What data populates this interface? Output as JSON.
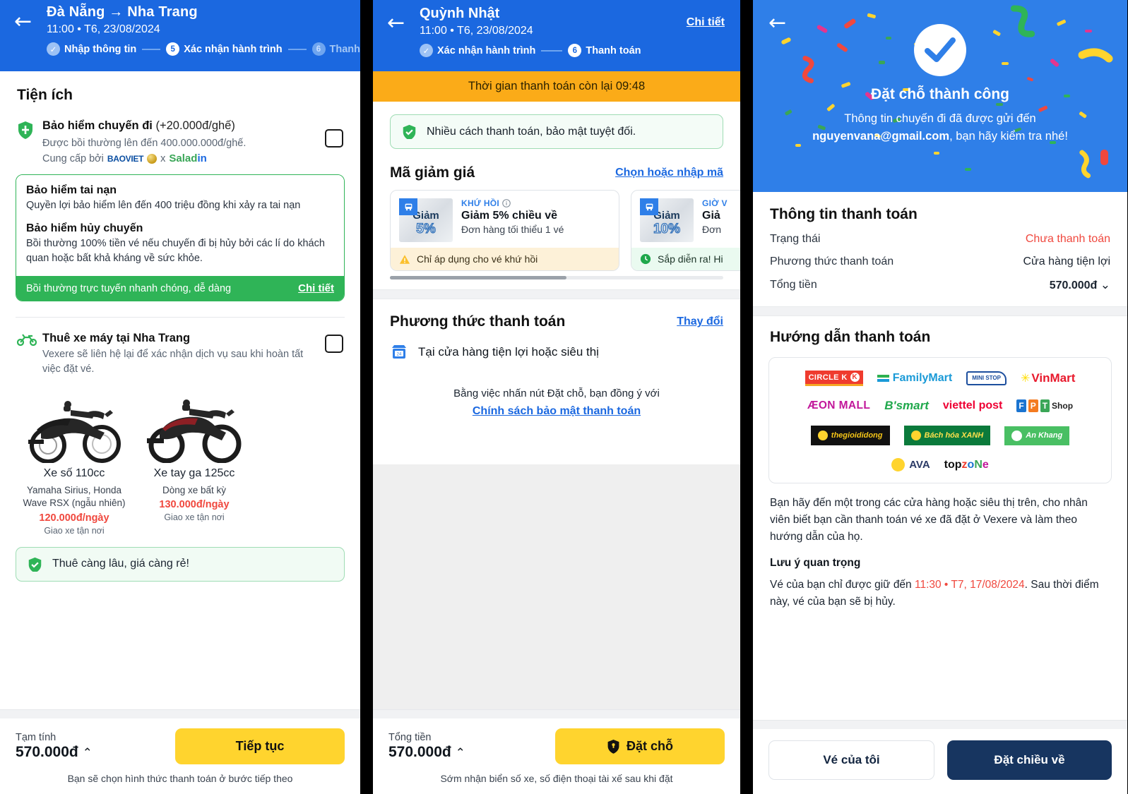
{
  "panel1": {
    "header": {
      "back_icon": "back-arrow-icon",
      "route": "Đà Nẵng → Nha Trang",
      "datetime": "11:00 • T6, 23/08/2024",
      "steps": [
        {
          "num": "✓",
          "label": "Nhập thông tin",
          "state": "done"
        },
        {
          "num": "5",
          "label": "Xác nhận hành trình",
          "state": "current"
        },
        {
          "num": "6",
          "label": "Thanh",
          "state": "next"
        }
      ]
    },
    "section_title": "Tiện ích",
    "insurance": {
      "icon": "shield-icon",
      "title": "Bảo hiểm chuyến đi",
      "price_suffix": "(+20.000đ/ghế)",
      "desc": "Được bồi thường lên đến 400.000.000đ/ghế.",
      "provided_by_label": "Cung cấp bởi",
      "brand1": "BAOVIET",
      "brand_sep": "x",
      "brand2": "Saladin",
      "checkbox": "insurance-checkbox"
    },
    "insurance_card": {
      "item1_title": "Bảo hiểm tai nạn",
      "item1_desc": "Quyền lợi bảo hiểm lên đến 400 triệu đồng khi xảy ra tai nạn",
      "item2_title": "Bảo hiểm hủy chuyến",
      "item2_desc": "Bồi thường 100% tiền vé nếu chuyến đi bị hủy bởi các lí do khách quan hoặc bất khả kháng về sức khỏe.",
      "foot_text": "Bồi thường trực tuyến nhanh chóng, dễ dàng",
      "foot_link": "Chi tiết"
    },
    "bike": {
      "icon": "motorbike-icon",
      "title": "Thuê xe máy tại Nha Trang",
      "desc": "Vexere sẽ liên hệ lại để xác nhận dịch vụ sau khi hoàn tất việc đặt vé.",
      "checkbox": "motorbike-checkbox",
      "options": [
        {
          "name": "Xe số 110cc",
          "desc": "Yamaha Sirius, Honda Wave RSX (ngẫu nhiên)",
          "price": "120.000đ/ngày",
          "note": "Giao xe tận nơi"
        },
        {
          "name": "Xe tay ga 125cc",
          "desc": "Dòng xe bất kỳ",
          "price": "130.000đ/ngày",
          "note": "Giao xe tận nơi"
        }
      ],
      "promo_note": "Thuê càng lâu, giá càng rẻ!"
    },
    "bottom": {
      "label": "Tạm tính",
      "amount": "570.000đ",
      "caret": "⌃",
      "button": "Tiếp tục",
      "foot": "Bạn sẽ chọn hình thức thanh toán ở bước tiếp theo"
    }
  },
  "panel2": {
    "header": {
      "back_icon": "back-arrow-icon",
      "title": "Quỳnh Nhật",
      "datetime": "11:00 • T6, 23/08/2024",
      "detail_link": "Chi tiết",
      "steps": [
        {
          "num": "✓",
          "label": "Xác nhận hành trình",
          "state": "done"
        },
        {
          "num": "6",
          "label": "Thanh toán",
          "state": "current"
        }
      ]
    },
    "timer": "Thời gian thanh toán còn lại 09:48",
    "secure_note": "Nhiều cách thanh toán, bảo mật tuyệt đối.",
    "voucher_section": {
      "title": "Mã giảm giá",
      "link": "Chọn hoặc nhập mã",
      "items": [
        {
          "thumb_label": "Giảm",
          "thumb_pct": "5%",
          "tag": "KHỨ HỒI",
          "tag_icon": "info-icon",
          "title": "Giảm 5% chiều về",
          "desc": "Đơn hàng tối thiểu 1 vé",
          "foot_icon": "warning-icon",
          "foot": "Chỉ áp dụng cho vé khứ hồi",
          "foot_style": "warn"
        },
        {
          "thumb_label": "Giảm",
          "thumb_pct": "10%",
          "tag": "GIỜ V",
          "tag_icon": "info-icon",
          "title": "Giả",
          "desc": "Đơn",
          "foot_icon": "clock-icon",
          "foot": "Sắp diễn ra! Hi",
          "foot_style": "ok"
        }
      ]
    },
    "payment_section": {
      "title": "Phương thức thanh toán",
      "link": "Thay đổi",
      "method_icon": "convenience-store-icon",
      "method": "Tại cửa hàng tiện lợi hoặc siêu thị",
      "agree_text": "Bằng việc nhấn nút Đặt chỗ, bạn đồng ý với",
      "agree_link": "Chính sách bảo mật thanh toán"
    },
    "bottom": {
      "label": "Tổng tiền",
      "amount": "570.000đ",
      "caret": "⌃",
      "button_icon": "shield-icon",
      "button": "Đặt chỗ",
      "foot": "Sớm nhận biển số xe, số điện thoại tài xế sau khi đặt"
    }
  },
  "panel3": {
    "header": {
      "back_icon": "back-arrow-icon",
      "check_icon": "check-circle-icon",
      "title": "Đặt chỗ thành công",
      "sub_line1": "Thông tin chuyến đi đã được gửi đến",
      "email": "nguyenvana@gmail.com",
      "sub_line2": ", bạn hãy kiểm tra nhé!"
    },
    "payment_info": {
      "title": "Thông tin thanh toán",
      "rows": [
        {
          "label": "Trạng thái",
          "value": "Chưa thanh toán",
          "style": "red"
        },
        {
          "label": "Phương thức thanh toán",
          "value": "Cửa hàng tiện lợi",
          "style": ""
        },
        {
          "label": "Tổng tiền",
          "value": "570.000đ",
          "style": "bold",
          "caret": "⌄"
        }
      ]
    },
    "guide": {
      "title": "Hướng dẫn thanh toán",
      "stores_row1": [
        "CIRCLE K",
        "FamilyMart",
        "MINI STOP",
        "VinMart"
      ],
      "stores_row2": [
        "ÆON MALL",
        "B'smart",
        "viettel post",
        "FPT Shop"
      ],
      "stores_row3": [
        "thegioididong",
        "Bách hóa XANH",
        "An Khang"
      ],
      "stores_row4": [
        "AVA",
        "topzone"
      ],
      "body": "Bạn hãy đến một trong các cửa hàng hoặc siêu thị trên, cho nhân viên biết bạn cần thanh toán vé xe đã đặt ở Vexere và làm theo hướng dẫn của họ.",
      "note_title": "Lưu ý quan trọng",
      "note_pre": "Vé của bạn chỉ được giữ đến ",
      "note_deadline": "11:30 • T7, 17/08/2024",
      "note_post": ". Sau thời điểm này, vé của bạn sẽ bị hủy."
    },
    "bottom": {
      "btn_left": "Vé của tôi",
      "btn_right": "Đặt chiều về"
    }
  },
  "colors": {
    "brand_blue": "#1b68e0",
    "header_blue": "#2f7fe8",
    "yellow": "#ffd42e",
    "green": "#2fb457",
    "red": "#f0483e",
    "navy": "#173560",
    "orange": "#fbab18"
  }
}
